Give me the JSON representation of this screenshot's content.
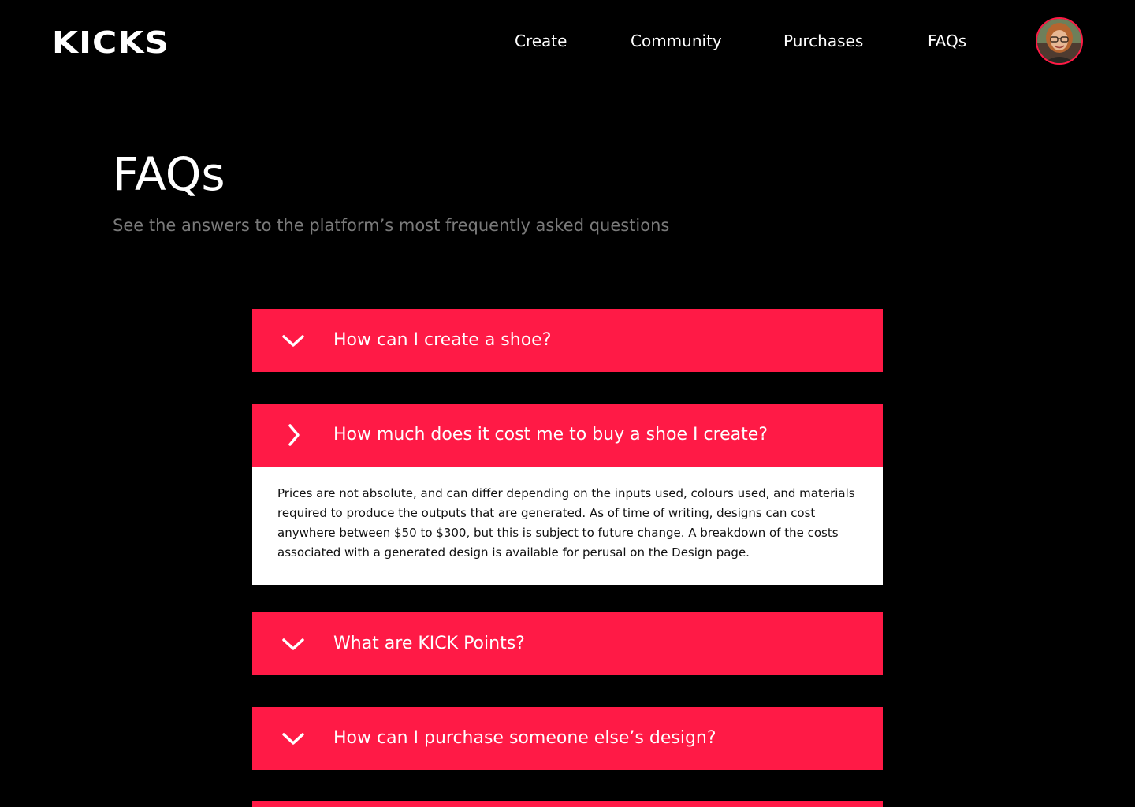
{
  "header": {
    "logo_text": "KICKS",
    "nav": [
      {
        "label": "Create"
      },
      {
        "label": "Community"
      },
      {
        "label": "Purchases"
      },
      {
        "label": "FAQs"
      }
    ],
    "avatar_icon": "user-avatar"
  },
  "main": {
    "title": "FAQs",
    "subtitle": "See the answers to the platform’s most frequently asked questions"
  },
  "faqs": [
    {
      "question": "How can I create a shoe?",
      "expanded": false,
      "icon": "chevron-down-icon"
    },
    {
      "question": "How much does it cost me to buy a shoe I create?",
      "expanded": true,
      "icon": "chevron-right-icon",
      "answer": "Prices are not absolute, and can differ depending on the inputs used, colours used, and materials required to produce the outputs that are generated. As of time of writing, designs can cost anywhere between $50 to $300, but this is subject to future change. A breakdown of the costs associated with a generated design is available for perusal on the Design page."
    },
    {
      "question": "What are KICK Points?",
      "expanded": false,
      "icon": "chevron-down-icon"
    },
    {
      "question": "How can I purchase someone else’s design?",
      "expanded": false,
      "icon": "chevron-down-icon"
    }
  ],
  "colors": {
    "background": "#000000",
    "accent": "#ff1a46",
    "subtitle": "#7a7a7a",
    "answer_bg": "#ffffff"
  }
}
